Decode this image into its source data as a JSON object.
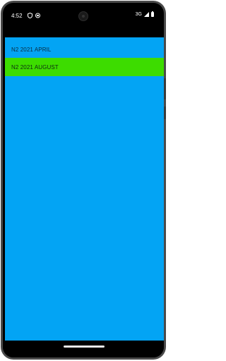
{
  "status_bar": {
    "time": "4:52",
    "network": "3G",
    "icons": [
      "shield-icon",
      "notification-icon",
      "signal-icon",
      "battery-icon"
    ]
  },
  "app": {
    "background_color": "#03a4f4",
    "items": [
      {
        "label": "N2 2021 APRIL",
        "color": "#03a4f4"
      },
      {
        "label": "N2 2021 AUGUST",
        "color": "#3ddc00"
      }
    ]
  }
}
